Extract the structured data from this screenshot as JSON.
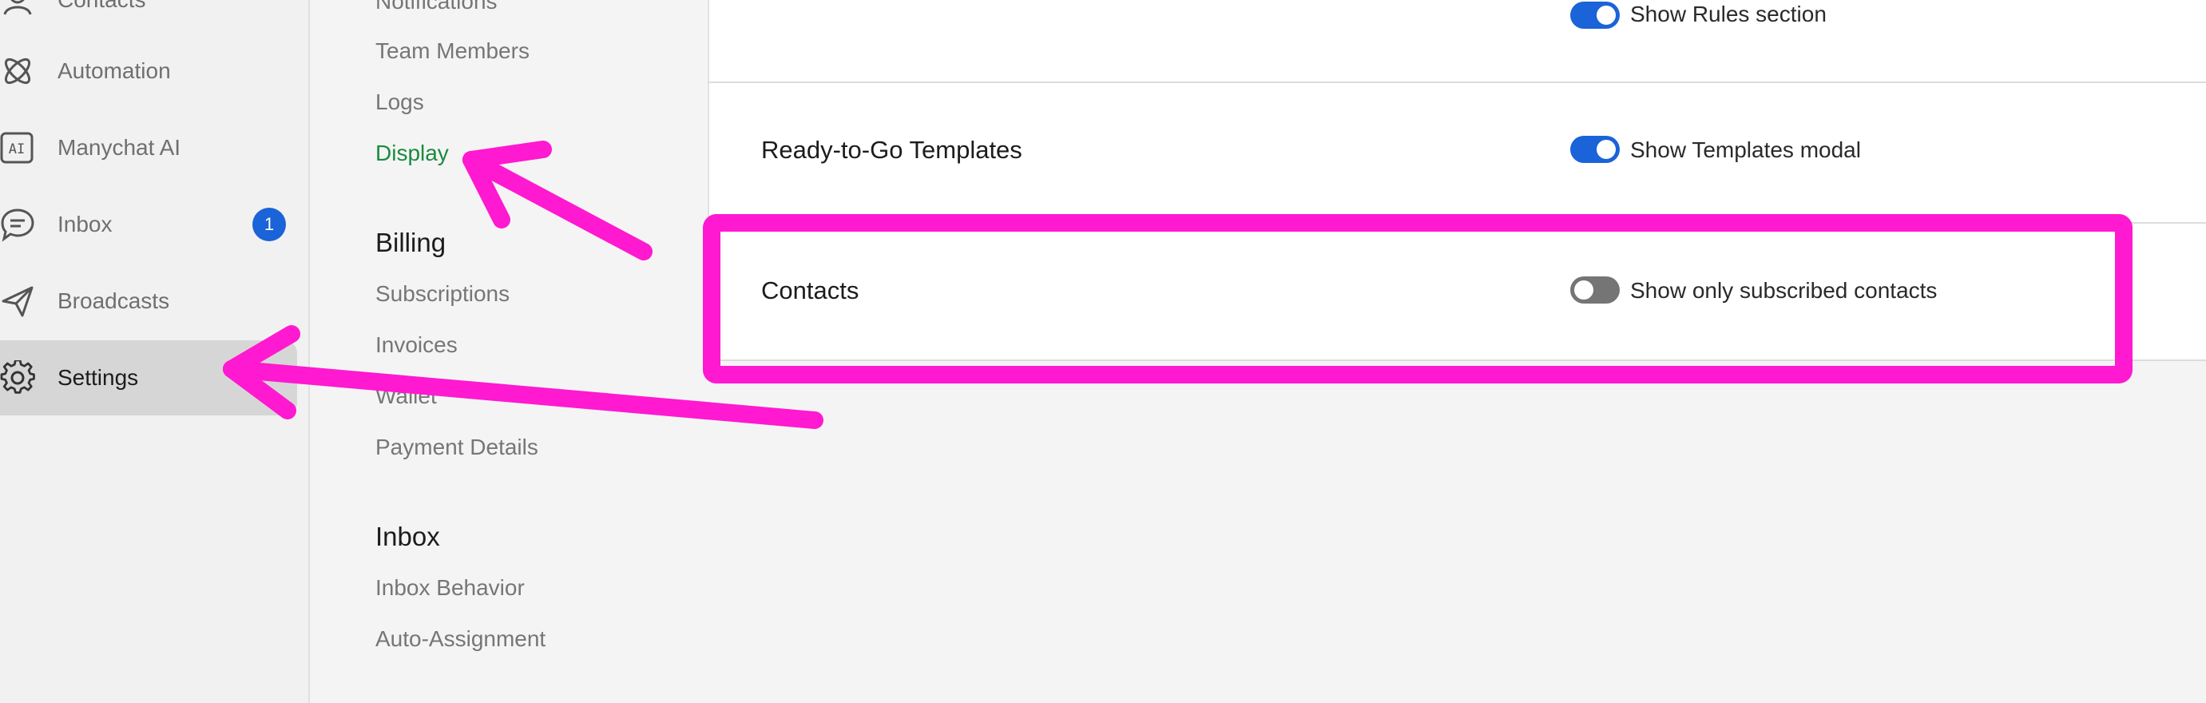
{
  "sidebar": {
    "items": [
      {
        "label": "Contacts",
        "icon": "user-icon"
      },
      {
        "label": "Automation",
        "icon": "automation-icon"
      },
      {
        "label": "Manychat AI",
        "icon": "ai-icon"
      },
      {
        "label": "Inbox",
        "icon": "chat-bubble-icon",
        "badge": "1"
      },
      {
        "label": "Broadcasts",
        "icon": "send-icon"
      },
      {
        "label": "Settings",
        "icon": "gear-icon",
        "active": true
      }
    ],
    "ai_icon_text": "AI"
  },
  "submenu": {
    "links_top": [
      "Notifications",
      "Team Members",
      "Logs",
      "Display"
    ],
    "active_link": "Display",
    "billing": {
      "heading": "Billing",
      "links": [
        "Subscriptions",
        "Invoices",
        "Wallet",
        "Payment Details"
      ]
    },
    "inbox": {
      "heading": "Inbox",
      "links": [
        "Inbox Behavior",
        "Auto-Assignment"
      ]
    }
  },
  "content": {
    "rows": [
      {
        "title": "",
        "toggle_label": "Show Rules section",
        "toggle_on": true
      },
      {
        "title": "Ready-to-Go Templates",
        "toggle_label": "Show Templates modal",
        "toggle_on": true
      },
      {
        "title": "Contacts",
        "toggle_label": "Show only subscribed contacts",
        "toggle_on": false
      }
    ]
  },
  "colors": {
    "accent_blue": "#1a63d8",
    "active_link_green": "#1c8b3d",
    "annotation_magenta": "#ff19d0",
    "toggle_off_gray": "#757575"
  }
}
